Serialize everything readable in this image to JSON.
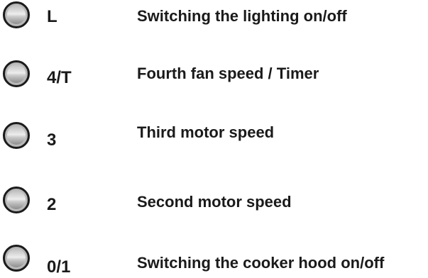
{
  "buttons": [
    {
      "key": "L",
      "description": "Switching the lighting on/off"
    },
    {
      "key": "4/T",
      "description": "Fourth fan speed / Timer"
    },
    {
      "key": "3",
      "description": "Third motor speed"
    },
    {
      "key": "2",
      "description": "Second motor speed"
    },
    {
      "key": "0/1",
      "description": "Switching the cooker hood on/off"
    }
  ]
}
